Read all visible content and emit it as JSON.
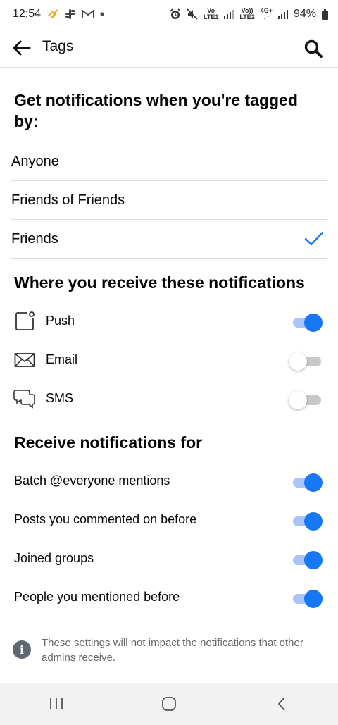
{
  "status_bar": {
    "time": "12:54",
    "network_1_label_top": "Vo",
    "network_1_label_bottom": "LTE1",
    "network_2_label_top": "Vo))",
    "network_2_label_bottom": "LTE2",
    "network_3_label_top": "4G+",
    "network_3_label_bottom": "↓↑",
    "battery": "94%"
  },
  "app_bar": {
    "title": "Tags"
  },
  "tagged_by": {
    "title": "Get notifications when you're tagged by:",
    "options": [
      {
        "label": "Anyone",
        "selected": false
      },
      {
        "label": "Friends of Friends",
        "selected": false
      },
      {
        "label": "Friends",
        "selected": true
      }
    ]
  },
  "channels": {
    "title": "Where you receive these notifications",
    "items": [
      {
        "label": "Push",
        "icon": "push-notification-icon",
        "enabled": true
      },
      {
        "label": "Email",
        "icon": "envelope-icon",
        "enabled": false
      },
      {
        "label": "SMS",
        "icon": "chat-bubbles-icon",
        "enabled": false
      }
    ]
  },
  "receive_for": {
    "title": "Receive notifications for",
    "items": [
      {
        "label": "Batch @everyone mentions",
        "enabled": true
      },
      {
        "label": "Posts you commented on before",
        "enabled": true
      },
      {
        "label": "Joined groups",
        "enabled": true
      },
      {
        "label": "People you mentioned before",
        "enabled": true
      }
    ]
  },
  "footer_note": {
    "icon": "info-icon",
    "text": "These settings will not impact the notifications that other admins receive."
  },
  "colors": {
    "accent": "#1877f2",
    "toggle_track_on": "#a9c5f7",
    "toggle_track_off": "#c8c8c8"
  }
}
